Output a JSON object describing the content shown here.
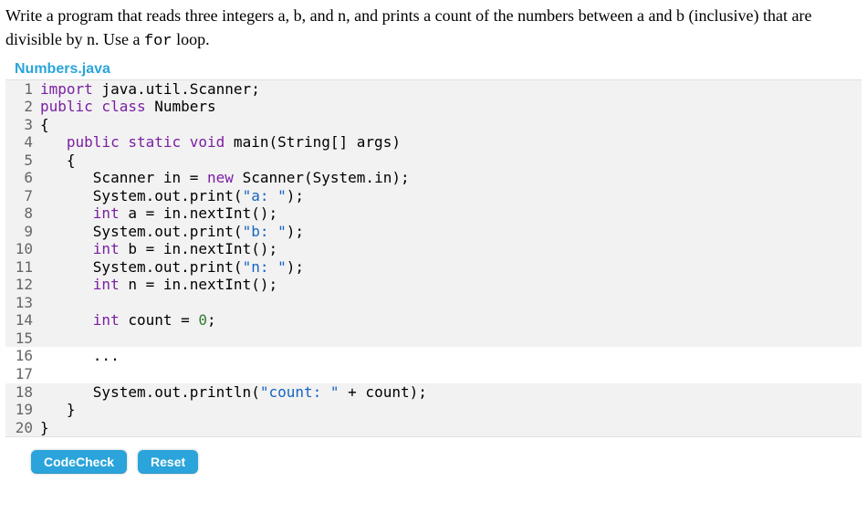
{
  "problem": {
    "prefix": "Write a program that reads three integers a, b, and n, and prints a count of the numbers between a and b (inclusive) that are divisible by n. Use a ",
    "code_word": "for",
    "suffix": " loop."
  },
  "file": {
    "name": "Numbers.java"
  },
  "code": {
    "lines": [
      {
        "no": 1,
        "editable": false,
        "tokens": [
          [
            "kw",
            "import"
          ],
          [
            "pln",
            " java.util.Scanner;"
          ]
        ]
      },
      {
        "no": 2,
        "editable": false,
        "tokens": [
          [
            "kw",
            "public class"
          ],
          [
            "pln",
            " Numbers"
          ]
        ]
      },
      {
        "no": 3,
        "editable": false,
        "tokens": [
          [
            "pln",
            "{"
          ]
        ]
      },
      {
        "no": 4,
        "editable": false,
        "tokens": [
          [
            "pln",
            "   "
          ],
          [
            "kw",
            "public static void"
          ],
          [
            "pln",
            " main(String[] args)"
          ]
        ]
      },
      {
        "no": 5,
        "editable": false,
        "tokens": [
          [
            "pln",
            "   {"
          ]
        ]
      },
      {
        "no": 6,
        "editable": false,
        "tokens": [
          [
            "pln",
            "      Scanner in = "
          ],
          [
            "kw",
            "new"
          ],
          [
            "pln",
            " Scanner(System.in);"
          ]
        ]
      },
      {
        "no": 7,
        "editable": false,
        "tokens": [
          [
            "pln",
            "      System.out.print("
          ],
          [
            "str",
            "\"a: \""
          ],
          [
            "pln",
            ");"
          ]
        ]
      },
      {
        "no": 8,
        "editable": false,
        "tokens": [
          [
            "pln",
            "      "
          ],
          [
            "kw",
            "int"
          ],
          [
            "pln",
            " a = in.nextInt();"
          ]
        ]
      },
      {
        "no": 9,
        "editable": false,
        "tokens": [
          [
            "pln",
            "      System.out.print("
          ],
          [
            "str",
            "\"b: \""
          ],
          [
            "pln",
            ");"
          ]
        ]
      },
      {
        "no": 10,
        "editable": false,
        "tokens": [
          [
            "pln",
            "      "
          ],
          [
            "kw",
            "int"
          ],
          [
            "pln",
            " b = in.nextInt();"
          ]
        ]
      },
      {
        "no": 11,
        "editable": false,
        "tokens": [
          [
            "pln",
            "      System.out.print("
          ],
          [
            "str",
            "\"n: \""
          ],
          [
            "pln",
            ");"
          ]
        ]
      },
      {
        "no": 12,
        "editable": false,
        "tokens": [
          [
            "pln",
            "      "
          ],
          [
            "kw",
            "int"
          ],
          [
            "pln",
            " n = in.nextInt();"
          ]
        ]
      },
      {
        "no": 13,
        "editable": false,
        "tokens": [
          [
            "pln",
            ""
          ]
        ]
      },
      {
        "no": 14,
        "editable": false,
        "tokens": [
          [
            "pln",
            "      "
          ],
          [
            "kw",
            "int"
          ],
          [
            "pln",
            " count = "
          ],
          [
            "num",
            "0"
          ],
          [
            "pln",
            ";"
          ]
        ]
      },
      {
        "no": 15,
        "editable": false,
        "tokens": [
          [
            "pln",
            ""
          ]
        ]
      },
      {
        "no": 16,
        "editable": true,
        "tokens": [
          [
            "pln",
            "      ..."
          ]
        ]
      },
      {
        "no": 17,
        "editable": true,
        "tokens": [
          [
            "pln",
            ""
          ]
        ]
      },
      {
        "no": 18,
        "editable": false,
        "tokens": [
          [
            "pln",
            "      System.out.println("
          ],
          [
            "str",
            "\"count: \""
          ],
          [
            "pln",
            " + count);"
          ]
        ]
      },
      {
        "no": 19,
        "editable": false,
        "tokens": [
          [
            "pln",
            "   }"
          ]
        ]
      },
      {
        "no": 20,
        "editable": false,
        "tokens": [
          [
            "pln",
            "}"
          ]
        ]
      }
    ]
  },
  "buttons": {
    "check": "CodeCheck",
    "reset": "Reset"
  }
}
